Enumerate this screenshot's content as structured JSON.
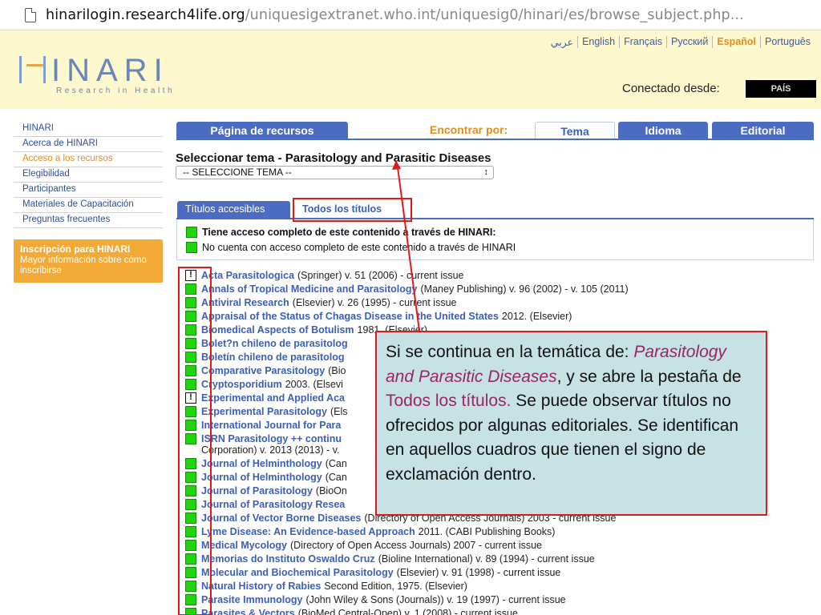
{
  "browser": {
    "url_host": "hinarilogin.research4life.org",
    "url_path": "/uniquesigextranet.who.int/uniquesig0/hinari/es/browse_subject.php..."
  },
  "header": {
    "logo_text": "HINARI",
    "logo_tagline": "Research in Health",
    "languages": [
      "عربي",
      "English",
      "Français",
      "Русский",
      "Español",
      "Português"
    ],
    "active_language": "Español",
    "connected_label": "Conectado desde:",
    "country_button": "PAÍS"
  },
  "sidebar": {
    "items": [
      {
        "label": "HINARI",
        "active": false
      },
      {
        "label": "Acerca de HINARI",
        "active": false
      },
      {
        "label": "Acceso a los recursos",
        "active": true
      },
      {
        "label": "Elegibilidad",
        "active": false
      },
      {
        "label": "Participantes",
        "active": false
      },
      {
        "label": "Materiales de Capacitación",
        "active": false
      },
      {
        "label": "Preguntas frecuentes",
        "active": false
      }
    ],
    "register": {
      "title": "Inscripción para HINARI",
      "text": "Mayor información sobre cómo inscribirse"
    }
  },
  "tabs": {
    "resources": "Página de recursos",
    "find_by": "Encontrar por:",
    "subject": "Tema",
    "language": "Idioma",
    "publisher": "Editorial"
  },
  "selector": {
    "title": "Seleccionar tema - Parasitology and Parasitic Diseases",
    "select_value": "-- SELECCIONE TEMA --"
  },
  "subtabs": {
    "accessible": "Títulos accesibles",
    "all": "Todos los títulos"
  },
  "legend": {
    "full": "Tiene acceso completo de este contenido a través de HINARI:",
    "partial": "No cuenta con acceso completo de este contenido a través de HINARI"
  },
  "titles": [
    {
      "status": "partial",
      "name": "Acta Parasitologica",
      "info": "(Springer) v. 51 (2006) - current issue"
    },
    {
      "status": "full",
      "name": "Annals of Tropical Medicine and Parasitology",
      "info": "(Maney Publishing) v. 96 (2002) - v. 105 (2011)"
    },
    {
      "status": "full",
      "name": "Antiviral Research",
      "info": "(Elsevier) v. 26 (1995) - current issue"
    },
    {
      "status": "full",
      "name": "Appraisal of the Status of Chagas Disease in the United States",
      "info": "2012. (Elsevier)"
    },
    {
      "status": "full",
      "name": "Biomedical Aspects of Botulism",
      "info": "1981. (Elsevier)"
    },
    {
      "status": "full",
      "name": "Bolet?n chileno de parasitolog",
      "info": ""
    },
    {
      "status": "full",
      "name": "Boletín chileno de parasitolog",
      "info": ""
    },
    {
      "status": "full",
      "name": "Comparative Parasitology",
      "info": "(Bio"
    },
    {
      "status": "full",
      "name": "Cryptosporidium",
      "info": "2003. (Elsevi"
    },
    {
      "status": "partial",
      "name": "Experimental and Applied Aca",
      "info": ""
    },
    {
      "status": "full",
      "name": "Experimental Parasitology",
      "info": "(Els"
    },
    {
      "status": "full",
      "name": "International Journal for Para",
      "info": ""
    },
    {
      "status": "full",
      "name": "ISRN Parasitology ++ continu",
      "info": "",
      "line2": "Corporation) v. 2013 (2013) - v."
    },
    {
      "status": "full",
      "name": "Journal of Helminthology",
      "info": "(Can"
    },
    {
      "status": "full",
      "name": "Journal of Helminthology",
      "info": "(Can"
    },
    {
      "status": "full",
      "name": "Journal of Parasitology",
      "info": "(BioOn"
    },
    {
      "status": "full",
      "name": "Journal of Parasitology Resea",
      "info": ""
    },
    {
      "status": "full",
      "name": "Journal of Vector Borne Diseases",
      "info": "(Directory of Open Access Journals) 2003 - current issue"
    },
    {
      "status": "full",
      "name": "Lyme Disease: An Evidence-based Approach",
      "info": "2011. (CABI Publishing Books)"
    },
    {
      "status": "full",
      "name": "Medical Mycology",
      "info": "(Directory of Open Access Journals) 2007 - current issue"
    },
    {
      "status": "full",
      "name": "Memorias do Instituto Oswaldo Cruz",
      "info": "(Bioline International) v. 89 (1994) - current issue"
    },
    {
      "status": "full",
      "name": "Molecular and Biochemical Parasitology",
      "info": "(Elsevier) v. 91 (1998) - current issue"
    },
    {
      "status": "full",
      "name": "Natural History of Rabies",
      "info": "Second Edition, 1975. (Elsevier)"
    },
    {
      "status": "full",
      "name": "Parasite Immunology",
      "info": "(John Wiley & Sons (Journals)) v. 19 (1997) - current issue"
    },
    {
      "status": "full",
      "name": "Parasites & Vectors",
      "info": "(BioMed Central-Open) v. 1 (2008) - current issue"
    }
  ],
  "callout": {
    "part1": "Si se continua en la temática de: ",
    "topic": "Parasitology and Parasitic Diseases",
    "part2": ", y se abre la pestaña de ",
    "tab": "Todos los títulos.",
    "part3": " Se puede observar títulos no ofrecidos por algunas editoriales. Se identifican en aquellos cuadros que tienen el signo de exclamación dentro."
  },
  "colors": {
    "accent_blue": "#4b6cc1",
    "accent_orange": "#e58c1a",
    "header_bg": "#fef8cf",
    "annotation_red": "#e0191b",
    "callout_bg": "#c6e2e5",
    "status_full": "#1ed40b"
  }
}
